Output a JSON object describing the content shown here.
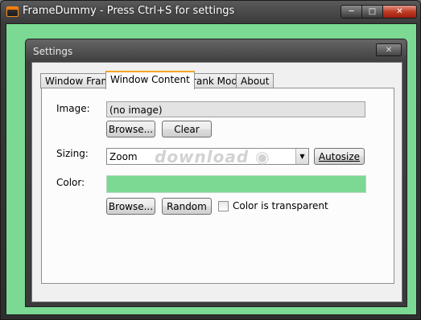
{
  "window": {
    "title": "FrameDummy - Press Ctrl+S for settings",
    "minimize_glyph": "─",
    "maximize_glyph": "□",
    "close_glyph": "✕"
  },
  "dialog": {
    "title": "Settings",
    "close_glyph": "✕"
  },
  "tabs": [
    {
      "label": "Window Frame",
      "active": false
    },
    {
      "label": "Window Content",
      "active": true
    },
    {
      "label": "Prank Mode",
      "active": false
    },
    {
      "label": "About",
      "active": false
    }
  ],
  "content": {
    "image_label": "Image:",
    "image_value": "(no image)",
    "image_browse": "Browse...",
    "image_clear": "Clear",
    "sizing_label": "Sizing:",
    "sizing_value": "Zoom",
    "autosize": "Autosize",
    "color_label": "Color:",
    "color_value": "#7bd994",
    "color_browse": "Browse...",
    "color_random": "Random",
    "transparent_label": "Color is transparent",
    "transparent_checked": false
  },
  "watermark": "download",
  "colors": {
    "client_bg": "#7bd994",
    "active_tab_accent": "#f5a623"
  }
}
